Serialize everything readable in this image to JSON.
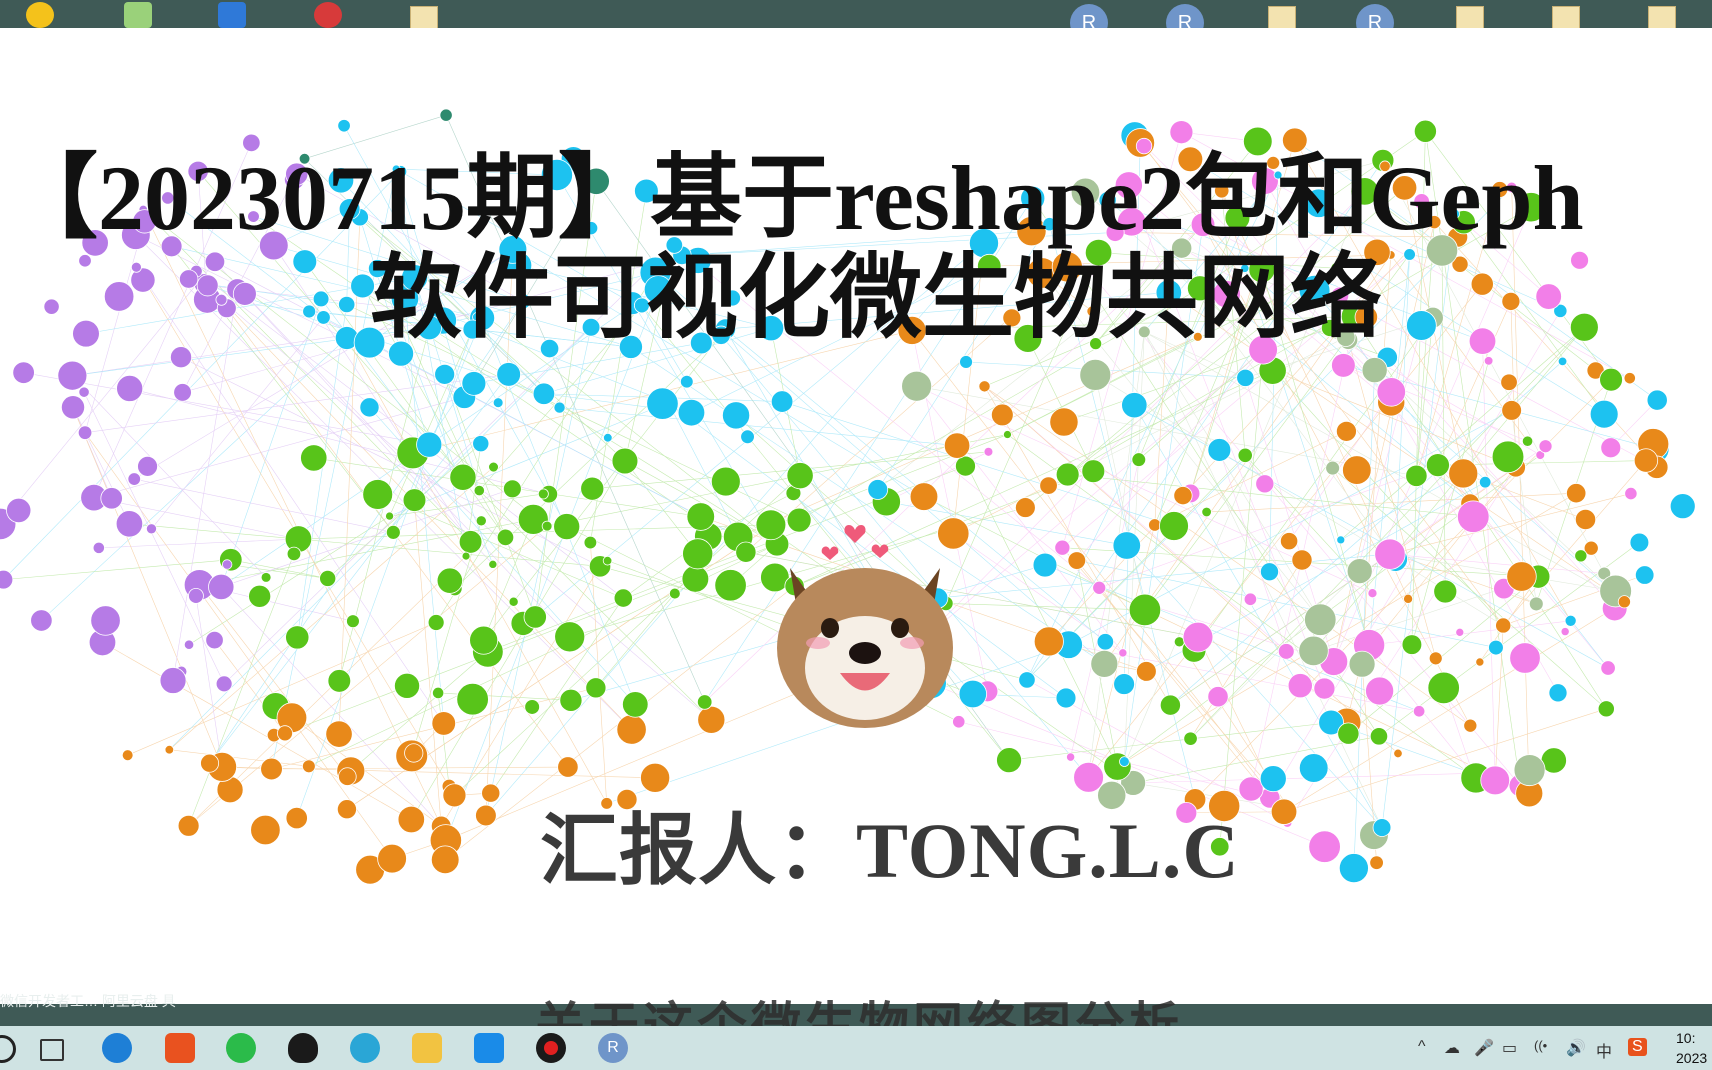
{
  "desktop": {
    "r_icon_label": "R"
  },
  "slide": {
    "title_line1": "【20230715期】基于reshape2包和Geph",
    "title_line2": "软件可视化微生物共网络",
    "reporter": "汇报人：TONG.L.C",
    "subtitle": "关于这个微生物网络图分析"
  },
  "left_desktop_label": "微信开发者工…   阿里云盘\n具",
  "taskbar": {
    "apps": [
      "search-icon",
      "task-view-icon",
      "edge-legacy-icon",
      "office-icon",
      "wechat-icon",
      "qq-icon",
      "edge-icon",
      "file-explorer-icon",
      "feishu-icon",
      "record-icon",
      "r-icon"
    ],
    "r_label": "R",
    "tray": [
      "^",
      "☁",
      "🎤",
      "▭",
      "((•",
      "🔊",
      "中",
      "S"
    ],
    "clock_time": "10:",
    "clock_date": "2023"
  },
  "colors": {
    "desktop_strip": "#3f5a56",
    "taskbar": "#cfe3e3",
    "node_purple": "#b67be6",
    "node_cyan": "#1dc2f0",
    "node_green": "#58c41a",
    "node_orange": "#e8891a",
    "node_pink": "#f27fe8",
    "node_teal": "#2e8a6e"
  }
}
